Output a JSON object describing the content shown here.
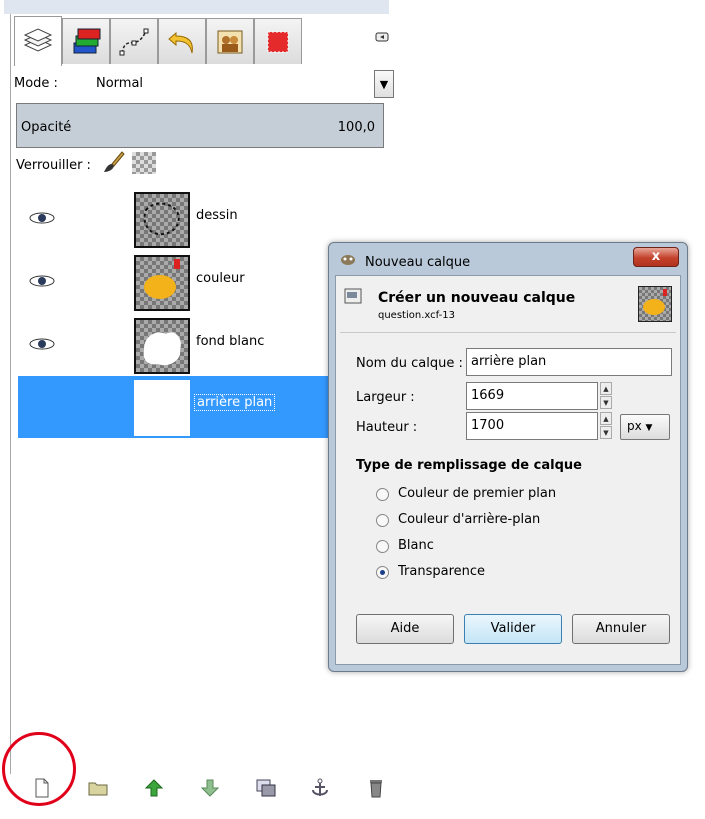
{
  "layers_panel": {
    "tabs": [
      {
        "icon": "layers-icon"
      },
      {
        "icon": "channels-icon"
      },
      {
        "icon": "paths-icon"
      },
      {
        "icon": "undo-history-icon"
      },
      {
        "icon": "images-icon"
      },
      {
        "icon": "fill-color-icon"
      }
    ],
    "mode_label": "Mode :",
    "mode_value": "Normal",
    "opacity_label": "Opacité",
    "opacity_value": "100,0",
    "lock_label": "Verrouiller :",
    "layers": [
      {
        "name": "dessin",
        "visible": true,
        "selected": false
      },
      {
        "name": "couleur",
        "visible": true,
        "selected": false
      },
      {
        "name": "fond blanc",
        "visible": true,
        "selected": false
      },
      {
        "name": "arrière plan",
        "visible": false,
        "selected": true
      }
    ],
    "bottom_buttons": [
      {
        "icon": "new-layer-icon"
      },
      {
        "icon": "new-layer-group-icon"
      },
      {
        "icon": "raise-layer-icon"
      },
      {
        "icon": "lower-layer-icon"
      },
      {
        "icon": "duplicate-layer-icon"
      },
      {
        "icon": "anchor-layer-icon"
      },
      {
        "icon": "delete-layer-icon"
      }
    ],
    "highlight_color": "#e0001a",
    "selected_color": "#3399ff"
  },
  "dialog": {
    "window_title": "Nouveau calque",
    "close_label": "x",
    "header_title": "Créer un nouveau calque",
    "header_subtitle": "question.xcf-13",
    "name_label": "Nom du calque :",
    "name_value": "arrière plan",
    "width_label": "Largeur :",
    "width_value": "1669",
    "height_label": "Hauteur :",
    "height_value": "1700",
    "unit_value": "px",
    "fill_section_title": "Type de remplissage de calque",
    "fill_options": [
      {
        "label": "Couleur de premier plan",
        "selected": false
      },
      {
        "label": "Couleur d'arrière-plan",
        "selected": false
      },
      {
        "label": "Blanc",
        "selected": false
      },
      {
        "label": "Transparence",
        "selected": true
      }
    ],
    "buttons": {
      "help": "Aide",
      "ok": "Valider",
      "cancel": "Annuler"
    }
  }
}
